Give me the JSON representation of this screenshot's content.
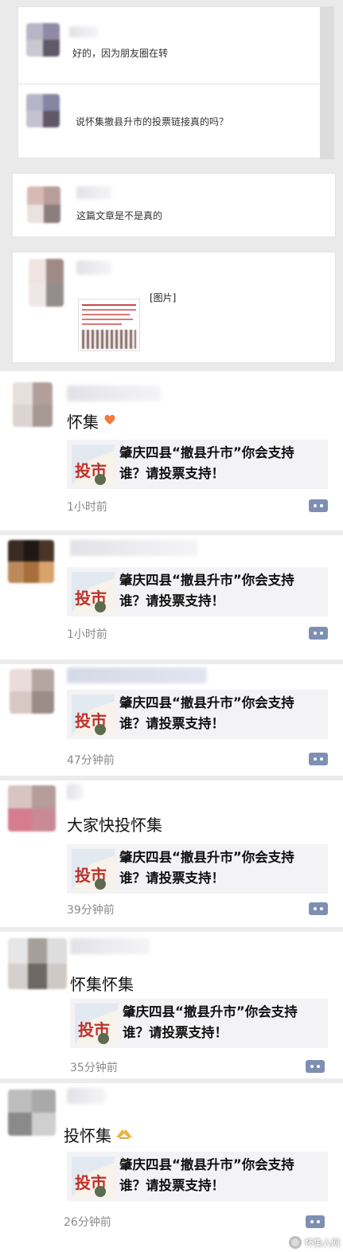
{
  "chats": [
    {
      "text": "好的，因为朋友圈在转"
    },
    {
      "text": "说怀集撤县升市的投票链接真的吗？"
    },
    {
      "text": "这篇文章是不是真的"
    },
    {
      "text": "[图片]"
    }
  ],
  "moments": [
    {
      "text": "怀集",
      "emoji": "heart-emoji",
      "share_title": "肇庆四县“撤县升市”你会支持谁？请投票支持！",
      "thumb_text": "投市",
      "time": "1小时前"
    },
    {
      "text": "",
      "emoji": "",
      "share_title": "肇庆四县“撤县升市”你会支持谁？请投票支持！",
      "thumb_text": "投市",
      "time": "1小时前"
    },
    {
      "text": "",
      "emoji": "",
      "share_title": "肇庆四县“撤县升市”你会支持谁？请投票支持！",
      "thumb_text": "投市",
      "time": "47分钟前"
    },
    {
      "text": "大家快投怀集",
      "emoji": "",
      "share_title": "肇庆四县“撤县升市”你会支持谁？请投票支持！",
      "thumb_text": "投市",
      "time": "39分钟前"
    },
    {
      "text": "怀集怀集",
      "emoji": "",
      "share_title": "肇庆四县“撤县升市”你会支持谁？请投票支持！",
      "thumb_text": "投市",
      "time": "35分钟前"
    },
    {
      "text": "投怀集",
      "emoji": "clap-emoji",
      "share_title": "肇庆四县“撤县升市”你会支持谁？请投票支持！",
      "thumb_text": "投市",
      "time": "26分钟前"
    }
  ],
  "watermark": "怀集人网",
  "colors": {
    "time": "#8a8a8a",
    "share_bg": "#f3f3f5",
    "more_btn": "#7d8fb2",
    "thumb_red": "#c0312b"
  }
}
